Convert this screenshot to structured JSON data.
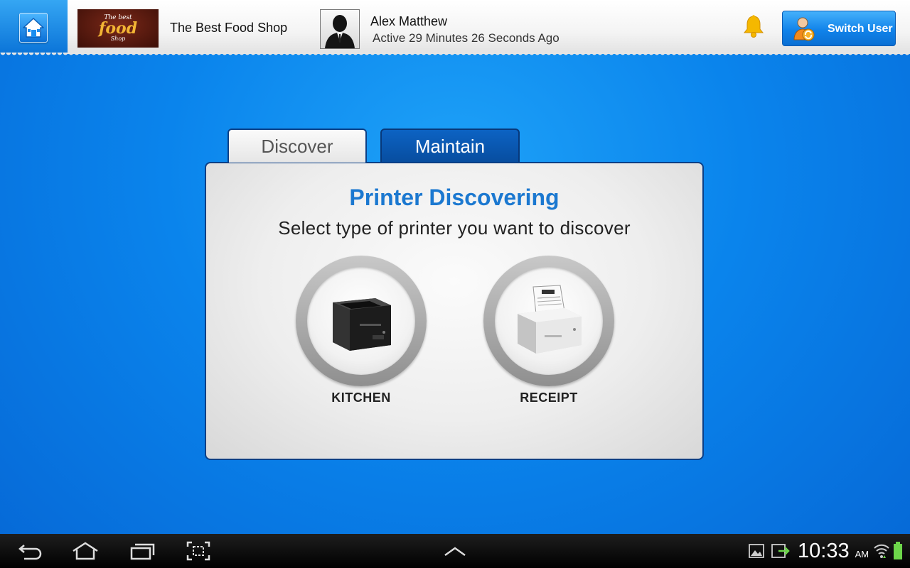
{
  "header": {
    "home_icon": "home-icon",
    "shop_logo": {
      "line1": "The best",
      "line2": "food",
      "line3": "Shop"
    },
    "shop_name": "The Best Food Shop",
    "user_name": "Alex Matthew",
    "user_status": "Active 29 Minutes 26 Seconds Ago",
    "notification_icon": "bell-icon",
    "switch_user_label": "Switch User"
  },
  "tabs": [
    {
      "label": "Discover",
      "active": true
    },
    {
      "label": "Maintain",
      "active": false
    }
  ],
  "panel": {
    "title": "Printer Discovering",
    "subtitle": "Select type of printer you want to discover",
    "options": [
      {
        "label": "KITCHEN",
        "icon": "kitchen-printer-icon"
      },
      {
        "label": "RECEIPT",
        "icon": "receipt-printer-icon"
      }
    ]
  },
  "navbar": {
    "icons": [
      "back-icon",
      "home-icon",
      "recent-apps-icon",
      "screenshot-icon",
      "up-arrow-icon",
      "gallery-icon",
      "sync-icon",
      "wifi-icon",
      "battery-icon"
    ],
    "time": "10:33",
    "ampm": "AM"
  },
  "colors": {
    "background": "#0a84ec",
    "title_blue": "#1b78d0",
    "tab_active_bg": "#f2f2f2",
    "tab_inactive_bg": "#0a58b2"
  }
}
